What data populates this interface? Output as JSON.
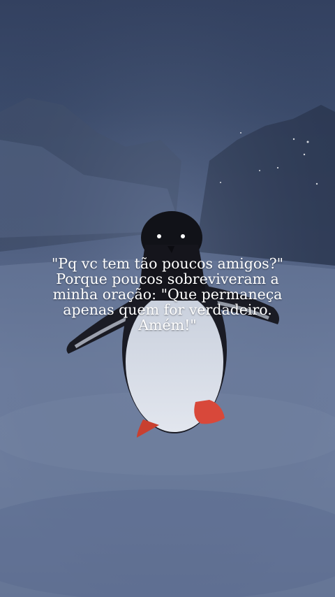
{
  "caption": {
    "lines": [
      "\"Pq vc tem tão poucos amigos?\"",
      "Porque poucos sobreviveram a",
      "minha oração: \"Que permaneça",
      "apenas quem for verdadeiro.",
      "Amém!\""
    ]
  },
  "scene": {
    "subject": "penguin-on-snow",
    "colors": {
      "sky": "#334160",
      "snow": "#6b7b9c",
      "penguin_head": "#15151c",
      "penguin_belly": "#d6dbe6",
      "penguin_feet": "#d8483a"
    }
  }
}
